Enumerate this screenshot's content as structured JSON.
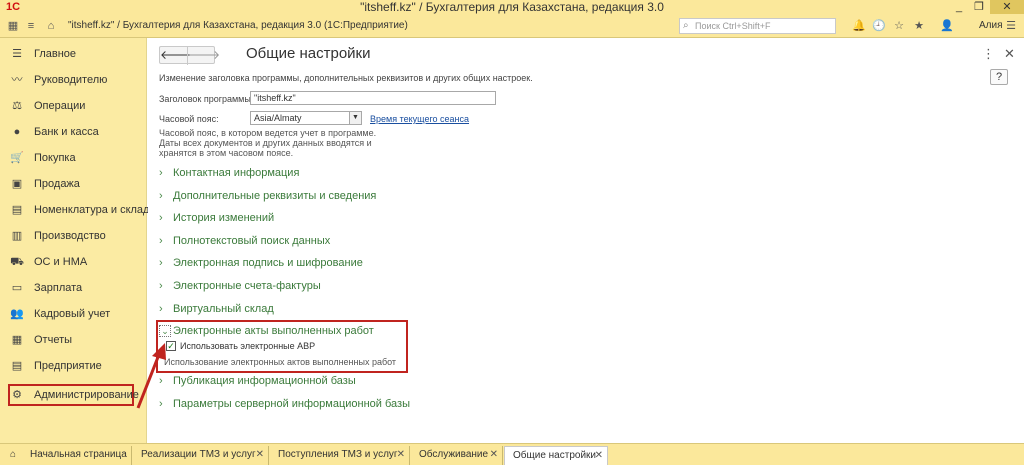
{
  "window": {
    "title": "\"itsheff.kz\" / Бухгалтерия для Казахстана, редакция 3.0",
    "logo": "1С"
  },
  "toolbar": {
    "path": "\"itsheff.kz\" / Бухгалтерия для Казахстана, редакция 3.0  (1С:Предприятие)",
    "search_placeholder": "Поиск Ctrl+Shift+F",
    "user": "Алия"
  },
  "sidebar": {
    "items": [
      {
        "label": "Главное",
        "icon": "menu-icon"
      },
      {
        "label": "Руководителю",
        "icon": "chart-icon"
      },
      {
        "label": "Операции",
        "icon": "operations-icon"
      },
      {
        "label": "Банк и касса",
        "icon": "bank-icon"
      },
      {
        "label": "Покупка",
        "icon": "cart-icon"
      },
      {
        "label": "Продажа",
        "icon": "bag-icon"
      },
      {
        "label": "Номенклатура и склад",
        "icon": "warehouse-icon"
      },
      {
        "label": "Производство",
        "icon": "factory-icon"
      },
      {
        "label": "ОС и НМА",
        "icon": "truck-icon"
      },
      {
        "label": "Зарплата",
        "icon": "salary-icon"
      },
      {
        "label": "Кадровый учет",
        "icon": "people-icon"
      },
      {
        "label": "Отчеты",
        "icon": "reports-icon"
      },
      {
        "label": "Предприятие",
        "icon": "enterprise-icon"
      },
      {
        "label": "Администрирование",
        "icon": "gear-icon"
      }
    ]
  },
  "main": {
    "title": "Общие настройки",
    "description": "Изменение заголовка программы, дополнительных реквизитов и других общих настроек.",
    "program_title_label": "Заголовок программы:",
    "program_title_value": "\"itsheff.kz\"",
    "timezone_label": "Часовой пояс:",
    "timezone_value": "Asia/Almaty",
    "session_time_link": "Время текущего сеанса",
    "timezone_note": "Часовой пояс, в котором ведется учет в программе. Даты всех документов и других данных вводятся и хранятся в этом часовом поясе.",
    "help": "?",
    "sections_before": [
      "Контактная информация",
      "Дополнительные реквизиты и сведения",
      "История изменений",
      "Полнотекстовый поиск данных",
      "Электронная подпись и шифрование",
      "Электронные счета-фактуры",
      "Виртуальный склад"
    ],
    "expanded_section": {
      "title": "Электронные акты выполненных работ",
      "checkbox_label": "Использовать электронные АВР",
      "checked": true,
      "hint": "Использование электронных актов выполненных работ"
    },
    "sections_after": [
      "Публикация информационной базы",
      "Параметры серверной информационной базы"
    ]
  },
  "tabs": [
    {
      "label": "Начальная страница",
      "closable": false
    },
    {
      "label": "Реализации ТМЗ и услуг",
      "closable": true
    },
    {
      "label": "Поступления ТМЗ и услуг",
      "closable": true
    },
    {
      "label": "Обслуживание",
      "closable": true
    },
    {
      "label": "Общие настройки",
      "closable": true,
      "active": true
    }
  ],
  "colors": {
    "chrome": "#fbe89b",
    "section_link": "#3a7a3a",
    "highlight": "#c0241f"
  }
}
